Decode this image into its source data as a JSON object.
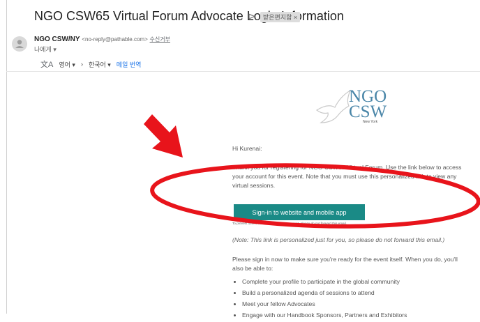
{
  "email": {
    "subject": "NGO CSW65 Virtual Forum Advocate Login Information",
    "label": "받은편지함 ×",
    "sender_name": "NGO CSW/NY",
    "sender_address": "<no-reply@pathable.com>",
    "unsubscribe": "수신거부",
    "to_line": "나에게 ▾"
  },
  "translate": {
    "from_lang": "영어 ▾",
    "arrow": "›",
    "to_lang": "한국어 ▾",
    "translate_link": "메일 번역"
  },
  "logo": {
    "line1": "NGO",
    "line2": "CSW",
    "line3": "New York"
  },
  "body": {
    "greeting": "Hi Kurenai:",
    "para1": "Thank you for registering for NGO CSW65 Virtual Forum. Use the link below to access your account for this event. Note that you must use this personalized link to view any virtual sessions.",
    "cta": "Sign-in to website and mobile app",
    "fine_print": "To prevent others from accessing your account, please do not forward this email.",
    "note": "(Note: This link is personalized just for you, so please do not forward this email.)",
    "para2": "Please sign in now to make sure you're ready for the event itself. When you do, you'll also be able to:",
    "bullets": [
      "Complete your profile to participate in the global community",
      "Build a personalized agenda of sessions to attend",
      "Meet your fellow Advocates",
      "Engage with our Handbook Sponsors, Partners and Exhibitors"
    ]
  },
  "colors": {
    "cta": "#1a8a86",
    "annotation": "#e8141b",
    "link": "#1a73e8"
  }
}
